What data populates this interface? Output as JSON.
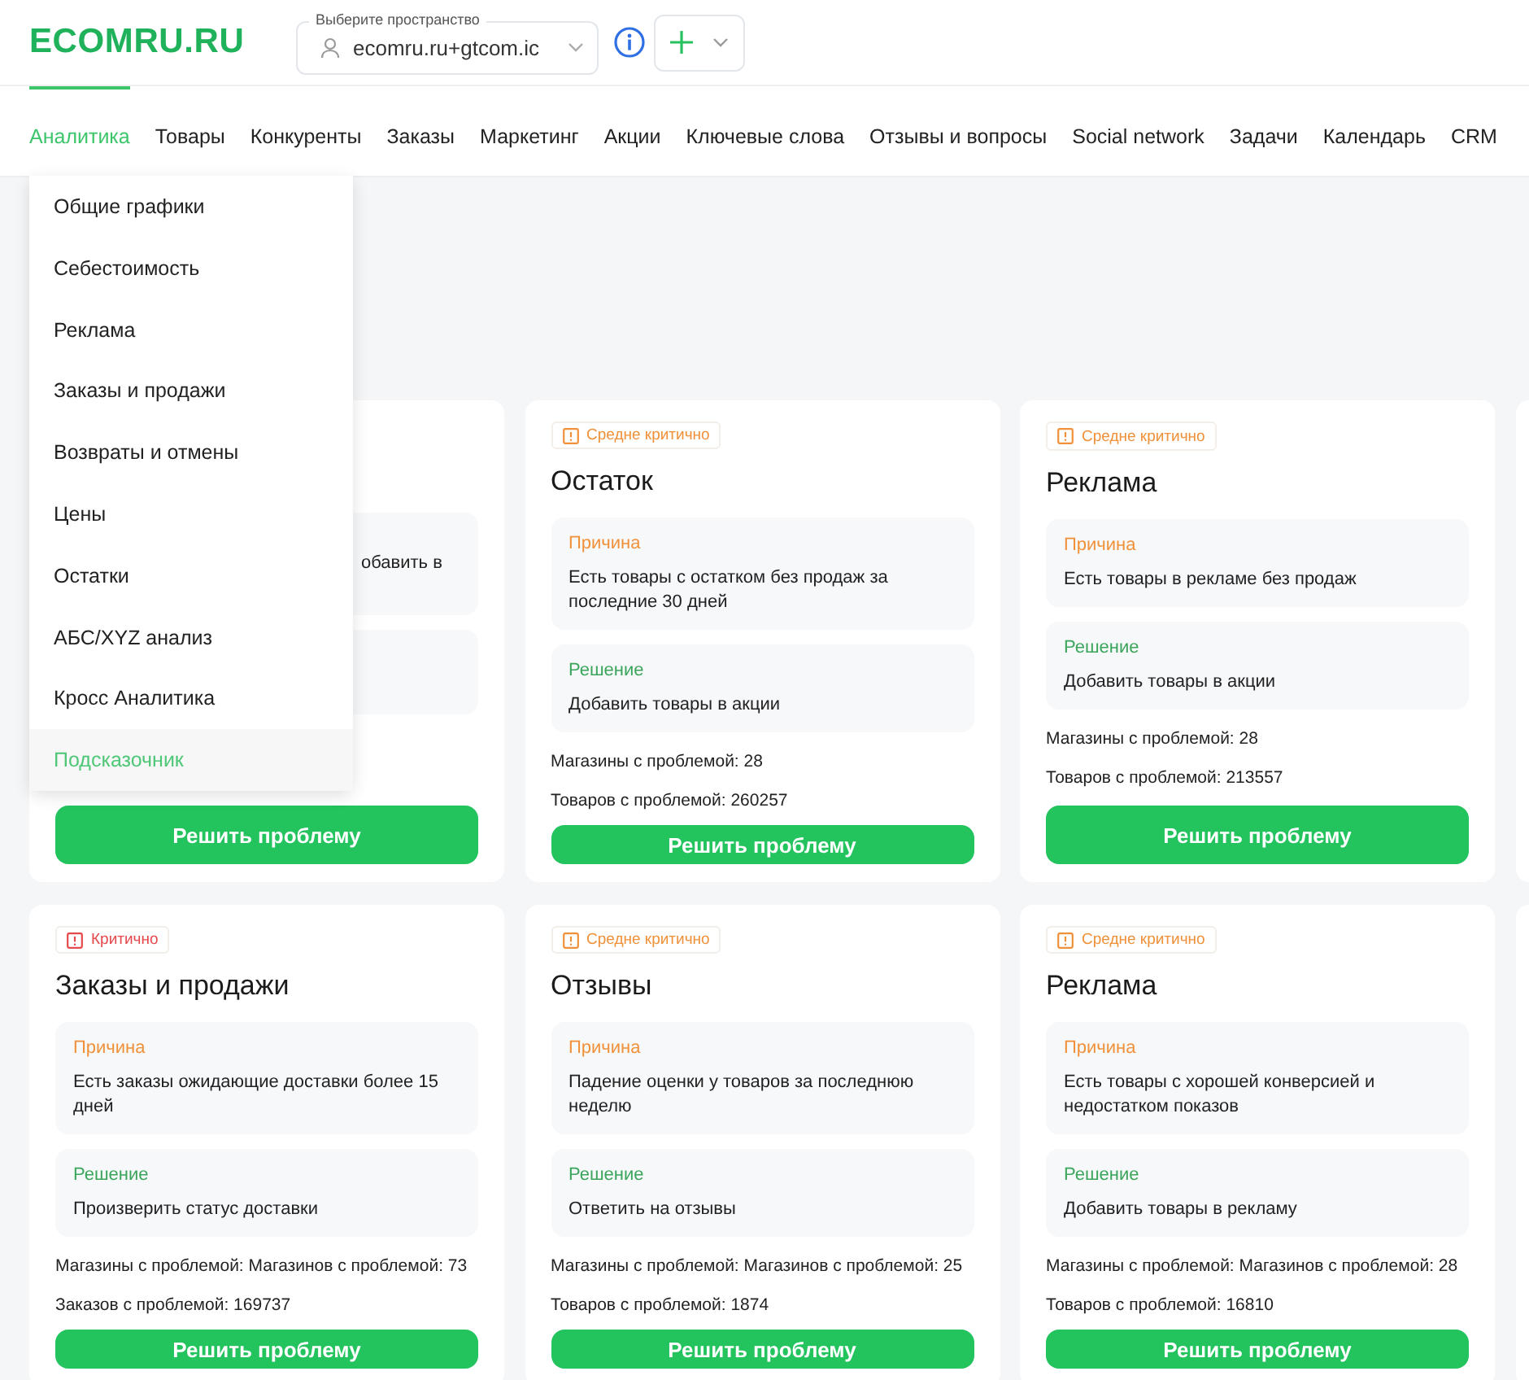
{
  "logo": "ECOMRU.RU",
  "workspace": {
    "label": "Выберите пространство",
    "value": "ecomru.ru+gtcom.ic"
  },
  "nav": [
    {
      "label": "Аналитика",
      "selected": true
    },
    {
      "label": "Товары",
      "selected": false
    },
    {
      "label": "Конкуренты",
      "selected": false
    },
    {
      "label": "Заказы",
      "selected": false
    },
    {
      "label": "Маркетинг",
      "selected": false
    },
    {
      "label": "Акции",
      "selected": false
    },
    {
      "label": "Ключевые слова",
      "selected": false
    },
    {
      "label": "Отзывы и вопросы",
      "selected": false
    },
    {
      "label": "Social network",
      "selected": false
    },
    {
      "label": "Задачи",
      "selected": false
    },
    {
      "label": "Календарь",
      "selected": false
    },
    {
      "label": "CRM",
      "selected": false
    }
  ],
  "dropdown": [
    {
      "label": "Общие графики",
      "selected": false
    },
    {
      "label": "Себестоимость",
      "selected": false
    },
    {
      "label": "Реклама",
      "selected": false
    },
    {
      "label": "Заказы и продажи",
      "selected": false
    },
    {
      "label": "Возвраты и отмены",
      "selected": false
    },
    {
      "label": "Цены",
      "selected": false
    },
    {
      "label": "Остатки",
      "selected": false
    },
    {
      "label": "АБС/XYZ анализ",
      "selected": false
    },
    {
      "label": "Кросс Аналитика",
      "selected": false
    },
    {
      "label": "Подсказочник",
      "selected": true
    }
  ],
  "cards": [
    {
      "kind": "covered",
      "reason_text": "обавить в",
      "button": "Решить проблему"
    },
    {
      "kind": "full",
      "color": "#f0913a",
      "badge": "Средне критично",
      "title": "Остаток",
      "reason_label": "Причина",
      "reason_text": "Есть товары с остатком без продаж за последние 30 дней",
      "solution_label": "Решение",
      "solution_text": "Добавить товары в акции",
      "stats": [
        "Магазины с проблемой: 28",
        "Товаров с проблемой: 260257"
      ],
      "button": "Решить проблему"
    },
    {
      "kind": "full",
      "color": "#f0913a",
      "badge": "Средне критично",
      "title": "Реклама",
      "reason_label": "Причина",
      "reason_text": "Есть товары в рекламе без продаж",
      "solution_label": "Решение",
      "solution_text": "Добавить товары в акции",
      "stats": [
        "Магазины с проблемой: 28",
        "Товаров с проблемой: 213557"
      ],
      "button": "Решить проблему"
    },
    {
      "kind": "edge"
    },
    {
      "kind": "full",
      "color": "#e5484d",
      "badge": "Критично",
      "title": "Заказы и продажи",
      "reason_label": "Причина",
      "reason_text": "Есть заказы ожидающие доставки более 15 дней",
      "solution_label": "Решение",
      "solution_text": "Произверить статус доставки",
      "stats": [
        "Магазины с проблемой: Магазинов с проблемой: 73",
        "Заказов с проблемой: 169737"
      ],
      "button": "Решить проблему"
    },
    {
      "kind": "full",
      "color": "#f0913a",
      "badge": "Средне критично",
      "title": "Отзывы",
      "reason_label": "Причина",
      "reason_text": "Падение оценки у товаров за последнюю неделю",
      "solution_label": "Решение",
      "solution_text": "Ответить на отзывы",
      "stats": [
        "Магазины с проблемой: Магазинов с проблемой: 25",
        "Товаров с проблемой: 1874"
      ],
      "button": "Решить проблему"
    },
    {
      "kind": "full",
      "color": "#f0913a",
      "badge": "Средне критично",
      "title": "Реклама",
      "reason_label": "Причина",
      "reason_text": "Есть товары с хорошей конверсией и недостатком показов",
      "solution_label": "Решение",
      "solution_text": "Добавить товары в рекламу",
      "stats": [
        "Магазины с проблемой: Магазинов с проблемой: 28",
        "Товаров с проблемой: 16810"
      ],
      "button": "Решить проблему"
    },
    {
      "kind": "edge"
    }
  ]
}
